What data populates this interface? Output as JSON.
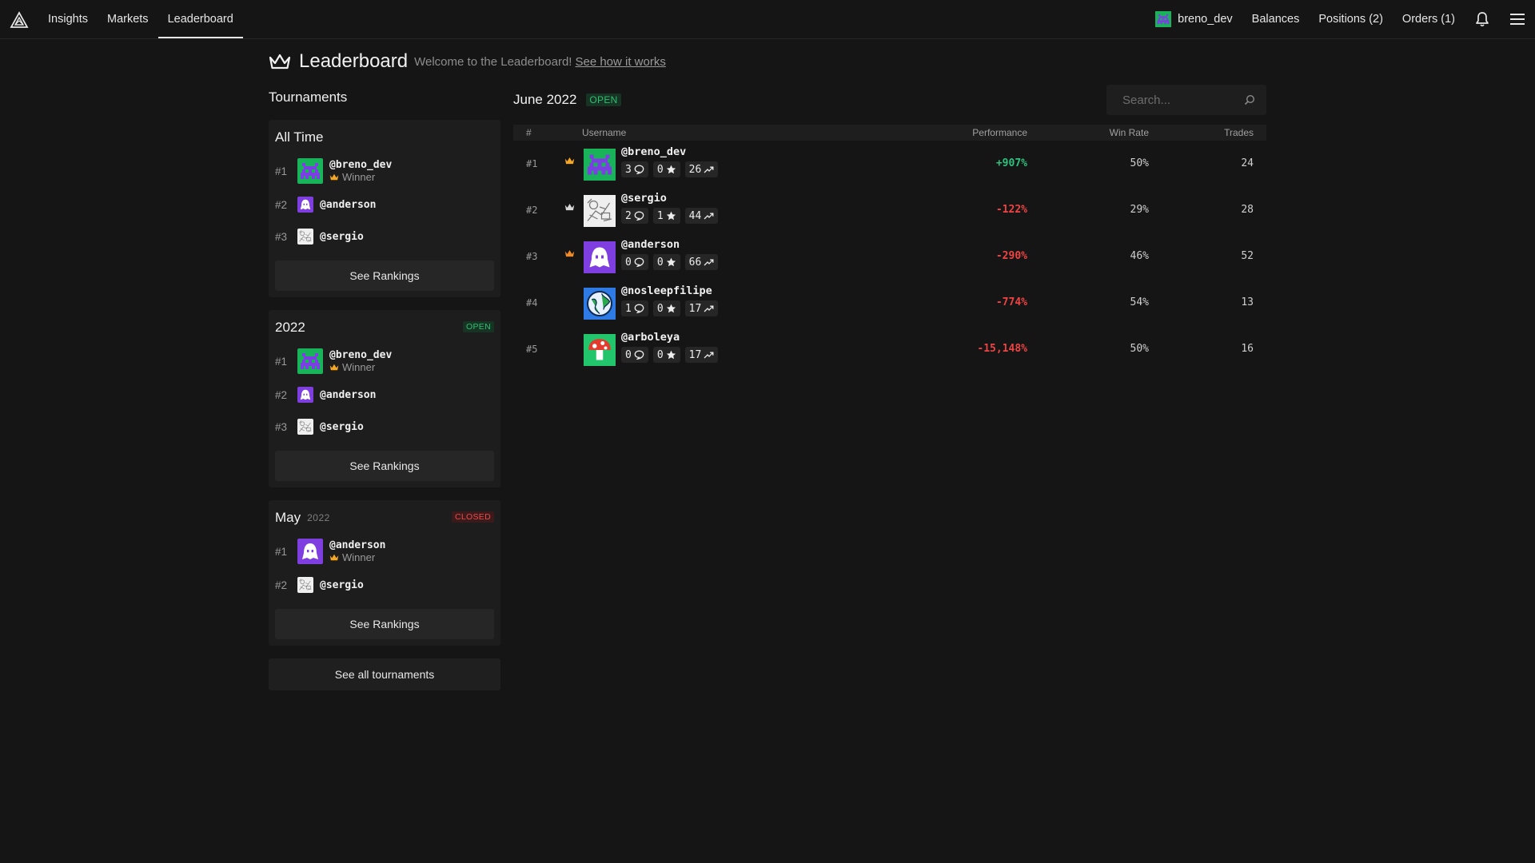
{
  "nav": {
    "links": [
      "Insights",
      "Markets",
      "Leaderboard"
    ],
    "active": "Leaderboard",
    "username": "breno_dev",
    "balances": "Balances",
    "positions": "Positions (2)",
    "orders": "Orders (1)"
  },
  "header": {
    "title": "Leaderboard",
    "subtitle": "Welcome to the Leaderboard!",
    "link": "See how it works"
  },
  "tournaments": {
    "title": "Tournaments",
    "cards": [
      {
        "title": "All Time",
        "entries": [
          {
            "rank": "#1",
            "user": "@breno_dev",
            "winner": "Winner"
          },
          {
            "rank": "#2",
            "user": "@anderson"
          },
          {
            "rank": "#3",
            "user": "@sergio"
          }
        ],
        "button": "See Rankings"
      },
      {
        "title": "2022",
        "badge": "OPEN",
        "entries": [
          {
            "rank": "#1",
            "user": "@breno_dev",
            "winner": "Winner"
          },
          {
            "rank": "#2",
            "user": "@anderson"
          },
          {
            "rank": "#3",
            "user": "@sergio"
          }
        ],
        "button": "See Rankings"
      },
      {
        "title": "May",
        "year": "2022",
        "badge": "CLOSED",
        "entries": [
          {
            "rank": "#1",
            "user": "@anderson",
            "winner": "Winner"
          },
          {
            "rank": "#2",
            "user": "@sergio"
          }
        ],
        "button": "See Rankings"
      }
    ],
    "all_button": "See all tournaments"
  },
  "ranking": {
    "month": "June 2022",
    "badge": "OPEN",
    "search_placeholder": "Search...",
    "columns": {
      "rank": "#",
      "username": "Username",
      "performance": "Performance",
      "win_rate": "Win Rate",
      "trades": "Trades"
    },
    "rows": [
      {
        "rank": "#1",
        "user": "@breno_dev",
        "comments": "3",
        "stars": "0",
        "predictions": "26",
        "performance": "+907%",
        "win_rate": "50%",
        "trades": "24",
        "crown": "gold"
      },
      {
        "rank": "#2",
        "user": "@sergio",
        "comments": "2",
        "stars": "1",
        "predictions": "44",
        "performance": "-122%",
        "win_rate": "29%",
        "trades": "28",
        "crown": "silver"
      },
      {
        "rank": "#3",
        "user": "@anderson",
        "comments": "0",
        "stars": "0",
        "predictions": "66",
        "performance": "-290%",
        "win_rate": "46%",
        "trades": "52",
        "crown": "bronze"
      },
      {
        "rank": "#4",
        "user": "@nosleepfilipe",
        "comments": "1",
        "stars": "0",
        "predictions": "17",
        "performance": "-774%",
        "win_rate": "54%",
        "trades": "13"
      },
      {
        "rank": "#5",
        "user": "@arboleya",
        "comments": "0",
        "stars": "0",
        "predictions": "17",
        "performance": "-15,148%",
        "win_rate": "50%",
        "trades": "16"
      }
    ]
  },
  "colors": {
    "background": "#151515",
    "positive": "#2ec27e",
    "negative": "#ef4444",
    "crown_gold": "#f5a623",
    "crown_silver": "#d8d8d8",
    "crown_bronze": "#f08a24"
  }
}
